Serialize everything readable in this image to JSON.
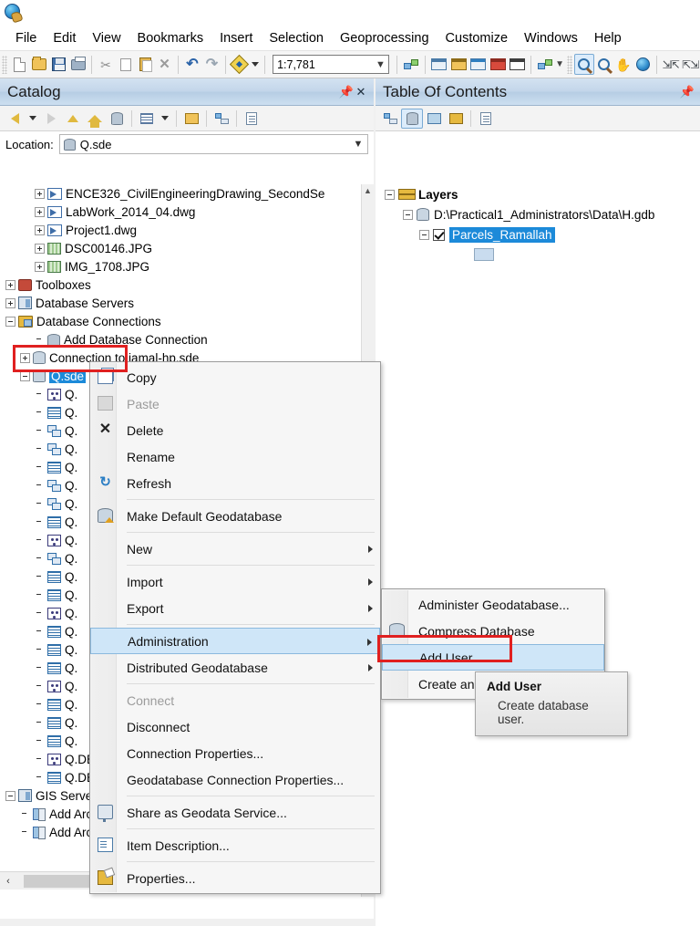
{
  "app": {
    "logo_icon": "arcmap-globe-icon"
  },
  "menubar": {
    "items": [
      {
        "label": "File"
      },
      {
        "label": "Edit"
      },
      {
        "label": "View"
      },
      {
        "label": "Bookmarks"
      },
      {
        "label": "Insert"
      },
      {
        "label": "Selection"
      },
      {
        "label": "Geoprocessing"
      },
      {
        "label": "Customize"
      },
      {
        "label": "Windows"
      },
      {
        "label": "Help"
      }
    ]
  },
  "toolbar": {
    "scale_value": "1:7,781",
    "buttons": [
      {
        "name": "new-map-button",
        "icon": "new-document-icon"
      },
      {
        "name": "open-button",
        "icon": "open-folder-icon"
      },
      {
        "name": "save-button",
        "icon": "floppy-disk-icon"
      },
      {
        "name": "print-button",
        "icon": "printer-icon"
      },
      {
        "name": "cut-button",
        "icon": "scissors-icon"
      },
      {
        "name": "copy-button",
        "icon": "copy-icon"
      },
      {
        "name": "paste-button",
        "icon": "paste-icon"
      },
      {
        "name": "delete-button",
        "icon": "x-icon"
      },
      {
        "name": "undo-button",
        "icon": "undo-arrow-icon"
      },
      {
        "name": "redo-button",
        "icon": "redo-arrow-icon"
      },
      {
        "name": "add-data-button",
        "icon": "add-data-icon"
      }
    ],
    "right_buttons": [
      {
        "name": "editor-toolbar-button",
        "icon": "editor-pencil-icon"
      },
      {
        "name": "table-of-contents-button",
        "icon": "toc-window-icon"
      },
      {
        "name": "catalog-window-button",
        "icon": "catalog-window-icon"
      },
      {
        "name": "search-window-button",
        "icon": "search-window-icon"
      },
      {
        "name": "arctoolbox-button",
        "icon": "arctoolbox-icon"
      },
      {
        "name": "python-window-button",
        "icon": "python-window-icon"
      },
      {
        "name": "model-builder-button",
        "icon": "model-builder-icon"
      },
      {
        "name": "zoom-in-button",
        "icon": "zoom-in-icon"
      },
      {
        "name": "zoom-out-button",
        "icon": "zoom-out-icon"
      },
      {
        "name": "pan-button",
        "icon": "pan-hand-icon"
      },
      {
        "name": "full-extent-button",
        "icon": "globe-icon"
      },
      {
        "name": "fixed-zoom-in-button",
        "icon": "fixed-zoom-in-icon"
      },
      {
        "name": "fixed-zoom-out-button",
        "icon": "fixed-zoom-out-icon"
      }
    ]
  },
  "catalog": {
    "title": "Catalog",
    "pin_icon": "pin-icon",
    "close_icon": "close-icon",
    "toolbar": [
      {
        "name": "back-button",
        "icon": "back-arrow-icon"
      },
      {
        "name": "back-dropdown",
        "icon": "chevron-down-icon"
      },
      {
        "name": "forward-button",
        "icon": "forward-arrow-icon"
      },
      {
        "name": "up-one-level-button",
        "icon": "up-level-icon"
      },
      {
        "name": "home-button",
        "icon": "home-folder-icon"
      },
      {
        "name": "default-geodatabase-button",
        "icon": "default-gdb-home-icon"
      },
      {
        "name": "contents-view-button",
        "icon": "grid-view-icon"
      },
      {
        "name": "contents-view-dropdown",
        "icon": "chevron-down-icon"
      },
      {
        "name": "connect-folder-button",
        "icon": "connect-folder-icon"
      },
      {
        "name": "toggle-tree-button",
        "icon": "tree-view-icon"
      },
      {
        "name": "item-description-button",
        "icon": "item-description-icon"
      }
    ],
    "location": {
      "label": "Location:",
      "value": "Q.sde",
      "db_icon": "database-icon",
      "chevron_icon": "chevron-down-icon"
    },
    "tree": [
      {
        "label": "ENCE326_CivilEngineeringDrawing_SecondSe",
        "indent": 2,
        "twist": "plus",
        "icon": "dwg-drawing-icon"
      },
      {
        "label": "LabWork_2014_04.dwg",
        "indent": 2,
        "twist": "plus",
        "icon": "dwg-drawing-icon"
      },
      {
        "label": "Project1.dwg",
        "indent": 2,
        "twist": "plus",
        "icon": "dwg-drawing-icon"
      },
      {
        "label": "DSC00146.JPG",
        "indent": 2,
        "twist": "plus",
        "icon": "raster-jpg-icon"
      },
      {
        "label": "IMG_1708.JPG",
        "indent": 2,
        "twist": "plus",
        "icon": "raster-jpg-icon"
      },
      {
        "label": "Toolboxes",
        "indent": 0,
        "twist": "plus",
        "icon": "toolbox-icon"
      },
      {
        "label": "Database Servers",
        "indent": 0,
        "twist": "plus",
        "icon": "database-server-icon"
      },
      {
        "label": "Database Connections",
        "indent": 0,
        "twist": "minus",
        "icon": "database-connections-icon"
      },
      {
        "label": "Add Database Connection",
        "indent": 2,
        "twist": "none",
        "icon": "add-database-connection-icon"
      },
      {
        "label": "Connection to jamal-hp.sde",
        "indent": 1,
        "twist": "plus",
        "icon": "sde-connection-icon"
      },
      {
        "label": "Q.sde",
        "indent": 1,
        "twist": "minus",
        "icon": "sde-connection-icon",
        "selected": true
      },
      {
        "label": "Q.",
        "indent": 2,
        "twist": "none",
        "icon": "point-feature-class-icon"
      },
      {
        "label": "Q.",
        "indent": 2,
        "twist": "none",
        "icon": "table-icon"
      },
      {
        "label": "Q.",
        "indent": 2,
        "twist": "none",
        "icon": "relationship-class-icon"
      },
      {
        "label": "Q.",
        "indent": 2,
        "twist": "none",
        "icon": "relationship-class-icon"
      },
      {
        "label": "Q.",
        "indent": 2,
        "twist": "none",
        "icon": "table-icon"
      },
      {
        "label": "Q.",
        "indent": 2,
        "twist": "none",
        "icon": "relationship-class-icon"
      },
      {
        "label": "Q.",
        "indent": 2,
        "twist": "none",
        "icon": "relationship-class-icon"
      },
      {
        "label": "Q.",
        "indent": 2,
        "twist": "none",
        "icon": "table-icon"
      },
      {
        "label": "Q.",
        "indent": 2,
        "twist": "none",
        "icon": "point-feature-class-icon"
      },
      {
        "label": "Q.",
        "indent": 2,
        "twist": "none",
        "icon": "relationship-class-icon"
      },
      {
        "label": "Q.",
        "indent": 2,
        "twist": "none",
        "icon": "table-icon"
      },
      {
        "label": "Q.",
        "indent": 2,
        "twist": "none",
        "icon": "table-icon"
      },
      {
        "label": "Q.",
        "indent": 2,
        "twist": "none",
        "icon": "point-feature-class-icon"
      },
      {
        "label": "Q.",
        "indent": 2,
        "twist": "none",
        "icon": "table-icon"
      },
      {
        "label": "Q.",
        "indent": 2,
        "twist": "none",
        "icon": "table-icon"
      },
      {
        "label": "Q.",
        "indent": 2,
        "twist": "none",
        "icon": "table-icon"
      },
      {
        "label": "Q.",
        "indent": 2,
        "twist": "none",
        "icon": "point-feature-class-icon"
      },
      {
        "label": "Q.",
        "indent": 2,
        "twist": "none",
        "icon": "table-icon"
      },
      {
        "label": "Q.",
        "indent": 2,
        "twist": "none",
        "icon": "table-icon"
      },
      {
        "label": "Q.",
        "indent": 2,
        "twist": "none",
        "icon": "table-icon"
      },
      {
        "label": "Q.DBO.Sites",
        "indent": 2,
        "twist": "none",
        "icon": "point-feature-class-icon"
      },
      {
        "label": "Q.DBO.UrbanMasterPlans_Data",
        "indent": 2,
        "twist": "none",
        "icon": "table-icon"
      },
      {
        "label": "GIS Servers",
        "indent": 0,
        "twist": "minus",
        "icon": "gis-servers-icon"
      },
      {
        "label": "Add ArcGIS Server",
        "indent": 1,
        "twist": "none",
        "icon": "add-arcgis-server-icon"
      },
      {
        "label": "Add ArcIMS Server",
        "indent": 1,
        "twist": "none",
        "icon": "add-arcims-server-icon"
      }
    ],
    "scroll": {
      "up_arrow": "▲",
      "down_arrow": "⌄",
      "left_arrow": "‹",
      "right_arrow": "›"
    }
  },
  "toc": {
    "title": "Table Of Contents",
    "pin_icon": "pin-icon",
    "toolbar": [
      {
        "name": "list-by-drawing-order-button",
        "icon": "list-by-drawing-order-icon"
      },
      {
        "name": "list-by-source-button",
        "icon": "list-by-source-icon",
        "selected": true
      },
      {
        "name": "list-by-visibility-button",
        "icon": "list-by-visibility-icon"
      },
      {
        "name": "list-by-selection-button",
        "icon": "list-by-selection-icon"
      },
      {
        "name": "options-button",
        "icon": "toc-options-icon"
      }
    ],
    "tree": {
      "layers_label": "Layers",
      "layers_icon": "layers-stack-icon",
      "gdb_path": "D:\\Practical1_Administrators\\Data\\H.gdb",
      "gdb_icon": "geodatabase-icon",
      "layer_name": "Parcels_Ramallah",
      "layer_checked": true,
      "symbol_swatch_color": "#c9dcef"
    }
  },
  "context_menu": {
    "items": [
      {
        "label": "Copy",
        "icon": "copy-icon",
        "state": "normal"
      },
      {
        "label": "Paste",
        "icon": "paste-icon",
        "state": "disabled"
      },
      {
        "label": "Delete",
        "icon": "delete-x-icon",
        "state": "normal"
      },
      {
        "label": "Rename",
        "icon": "",
        "state": "normal"
      },
      {
        "label": "Refresh",
        "icon": "refresh-icon",
        "state": "normal"
      },
      {
        "separator": true
      },
      {
        "label": "Make Default Geodatabase",
        "icon": "default-geodatabase-icon",
        "state": "normal"
      },
      {
        "separator": true
      },
      {
        "label": "New",
        "icon": "",
        "state": "normal",
        "submenu": true
      },
      {
        "separator": true
      },
      {
        "label": "Import",
        "icon": "",
        "state": "normal",
        "submenu": true
      },
      {
        "label": "Export",
        "icon": "",
        "state": "normal",
        "submenu": true
      },
      {
        "separator": true
      },
      {
        "label": "Administration",
        "icon": "",
        "state": "highlighted",
        "submenu": true
      },
      {
        "label": "Distributed Geodatabase",
        "icon": "",
        "state": "normal",
        "submenu": true
      },
      {
        "separator": true
      },
      {
        "label": "Connect",
        "icon": "",
        "state": "disabled"
      },
      {
        "label": "Disconnect",
        "icon": "",
        "state": "normal"
      },
      {
        "label": "Connection Properties...",
        "icon": "",
        "state": "normal"
      },
      {
        "label": "Geodatabase Connection Properties...",
        "icon": "",
        "state": "normal"
      },
      {
        "separator": true
      },
      {
        "label": "Share as Geodata Service...",
        "icon": "share-geodata-icon",
        "state": "normal"
      },
      {
        "separator": true
      },
      {
        "label": "Item Description...",
        "icon": "item-description-icon",
        "state": "normal"
      },
      {
        "separator": true
      },
      {
        "label": "Properties...",
        "icon": "properties-icon",
        "state": "normal"
      }
    ]
  },
  "submenu": {
    "items": [
      {
        "label": "Administer Geodatabase...",
        "icon": "",
        "state": "normal"
      },
      {
        "label": "Compress Database",
        "icon": "compress-database-icon",
        "state": "normal"
      },
      {
        "label": "Add User",
        "icon": "",
        "state": "highlighted"
      },
      {
        "label": "Create and Manage Roles",
        "icon": "",
        "state": "normal"
      }
    ]
  },
  "tooltip": {
    "title": "Add User",
    "body": "Create database user."
  },
  "annotations": {
    "highlight_color": "#e02020",
    "boxes": [
      {
        "name": "q-sde-node-highlight"
      },
      {
        "name": "add-user-menu-highlight"
      }
    ]
  }
}
